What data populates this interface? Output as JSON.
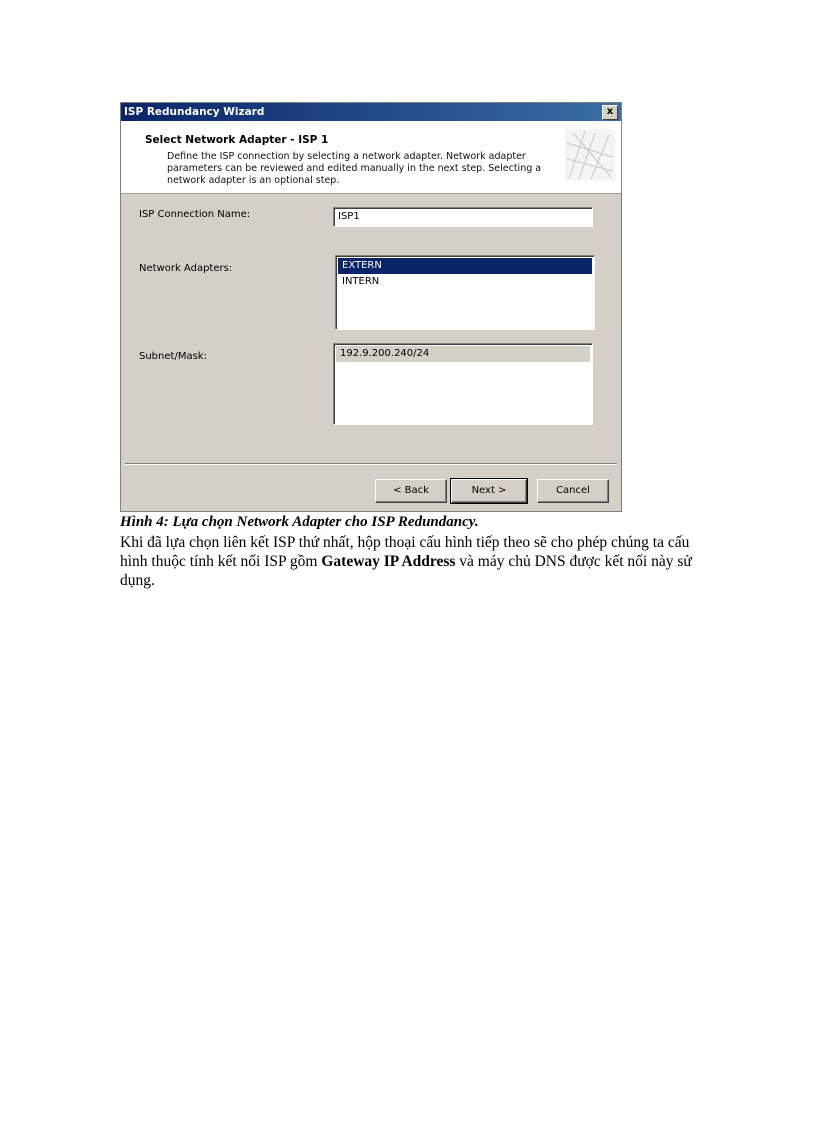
{
  "dialog": {
    "title": "ISP Redundancy Wizard",
    "close_label": "x",
    "header_title": "Select Network Adapter - ISP 1",
    "header_desc": "Define the ISP connection by selecting a network adapter. Network adapter parameters can be reviewed and edited manually in the next step. Selecting a network adapter is an optional step.",
    "connection_label": "ISP Connection Name:",
    "connection_value": "ISP1",
    "adapters_label": "Network Adapters:",
    "adapters": [
      {
        "name": "EXTERN",
        "selected": true
      },
      {
        "name": "INTERN",
        "selected": false
      }
    ],
    "subnet_label": "Subnet/Mask:",
    "subnets": [
      "192.9.200.240/24"
    ],
    "buttons": {
      "back": "< Back",
      "next": "Next >",
      "cancel": "Cancel"
    }
  },
  "caption": "Hình 4: Lựa chọn Network Adapter cho ISP Redundancy.",
  "paragraph": {
    "part1": "Khi đã lựa chọn liên kết ISP thứ nhất, hộp thoại cấu hình tiếp theo sẽ cho phép chúng ta cấu hình thuộc tính kết nối ISP gồm ",
    "bold": "Gateway IP Address",
    "part2": " và máy chủ DNS được kết nối này sử dụng."
  }
}
